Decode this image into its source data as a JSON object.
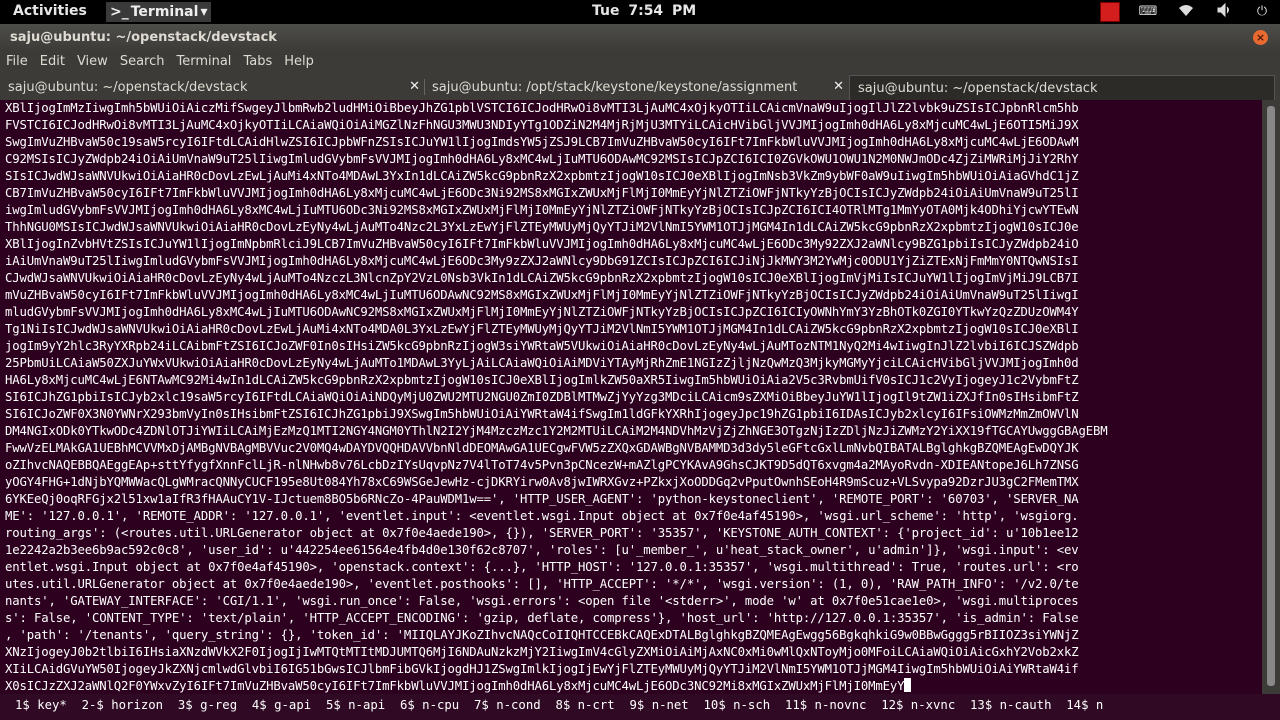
{
  "top_panel": {
    "activities": "Activities",
    "app_menu": "Terminal",
    "app_menu_icon": ">_",
    "clock": "Tue  7:54 PM",
    "tray_icons": [
      "indicator-red",
      "keyboard-icon",
      "wifi-icon",
      "volume-icon",
      "power-icon"
    ]
  },
  "window": {
    "title": "saju@ubuntu: ~/openstack/devstack",
    "close_glyph": "×"
  },
  "menu": [
    "File",
    "Edit",
    "View",
    "Search",
    "Terminal",
    "Tabs",
    "Help"
  ],
  "tabs": [
    {
      "label": "saju@ubuntu: ~/openstack/devstack",
      "close": "✕",
      "active": false
    },
    {
      "label": "saju@ubuntu: /opt/stack/keystone/keystone/assignment",
      "close": "✕",
      "active": false
    },
    {
      "label": "saju@ubuntu: ~/openstack/devstack",
      "close": "",
      "active": true
    }
  ],
  "terminal_lines": [
    "XBlIjogImMzIiwgImh5bWUiOiAiczMifSwgeyJlbmRwb2ludHMiOiBbeyJhZG1pblVSTCI6ICJodHRwOi8vMTI3LjAuMC4xOjkyOTIiLCAicmVnaW9uIjogIlJlZ2lvbk9uZSIsICJpbnRlcm5hb",
    "FVSTCI6ICJodHRwOi8vMTI3LjAuMC4xOjkyOTIiLCAiaWQiOiAiMGZlNzFhNGU3MWU3NDIyYTg1ODZiN2M4MjRjMjU3MTYiLCAicHVibGljVVJMIjogImh0dHA6Ly8xMjcuMC4wLjE6OTI5MiJ9X",
    "SwgImVuZHBvaW50c19saW5rcyI6IFtdLCAidHlwZSI6ICJpbWFnZSIsICJuYW1lIjogImdsYW5jZSJ9LCB7ImVuZHBvaW50cyI6IFt7ImFkbWluVVJMIjogImh0dHA6Ly8xMjcuMC4wLjE6ODAwM",
    "C92MSIsICJyZWdpb24iOiAiUmVnaW9uT25lIiwgImludGVybmFsVVJMIjogImh0dHA6Ly8xMC4wLjIuMTU6ODAwMC92MSIsICJpZCI6ICI0ZGVkOWU1OWU1N2M0NWJmODc4ZjZiMWRiMjJiY2RhY",
    "SIsICJwdWJsaWNVUkwiOiAiaHR0cDovLzEwLjAuMi4xNTo4MDAwL3YxIn1dLCAiZW5kcG9pbnRzX2xpbmtzIjogW10sICJ0eXBlIjogImNsb3VkZm9ybWF0aW9uIiwgIm5hbWUiOiAiaGVhdC1jZ",
    "CB7ImVuZHBvaW50cyI6IFt7ImFkbWluVVJMIjogImh0dHA6Ly8xMjcuMC4wLjE6ODc3Ni92MS8xMGIxZWUxMjFlMjI0MmEyYjNlZTZiOWFjNTkyYzBjOCIsICJyZWdpb24iOiAiUmVnaW9uT25lI",
    "iwgImludGVybmFsVVJMIjogImh0dHA6Ly8xMC4wLjIuMTU6ODc3Ni92MS8xMGIxZWUxMjFlMjI0MmEyYjNlZTZiOWFjNTkyYzBjOCIsICJpZCI6ICI4OTRlMTg1MmYyOTA0Mjk4ODhiYjcwYTEwN",
    "ThhNGU0MSIsICJwdWJsaWNVUkwiOiAiaHR0cDovLzEyNy4wLjAuMTo4Nzc2L3YxLzEwYjFlZTEyMWUyMjQyYTJiM2VlNmI5YWM1OTJjMGM4In1dLCAiZW5kcG9pbnRzX2xpbmtzIjogW10sICJ0e",
    "XBlIjogInZvbHVtZSIsICJuYW1lIjogImNpbmRlciJ9LCB7ImVuZHBvaW50cyI6IFt7ImFkbWluVVJMIjogImh0dHA6Ly8xMjcuMC4wLjE6ODc3My92ZXJ2aWNlcy9BZG1pbiIsICJyZWdpb24iO",
    "iAiUmVnaW9uT25lIiwgImludGVybmFsVVJMIjogImh0dHA6Ly8xMjcuMC4wLjE6ODc3My9zZXJ2aWNlcy9DbG91ZCIsICJpZCI6ICJiNjJkMWY3M2YwMjc0ODU1YjZiZTExNjFmMmY0NTQwNSIsI",
    "CJwdWJsaWNVUkwiOiAiaHR0cDovLzEyNy4wLjAuMTo4NzczL3NlcnZpY2VzL0Nsb3VkIn1dLCAiZW5kcG9pbnRzX2xpbmtzIjogW10sICJ0eXBlIjogImVjMiIsICJuYW1lIjogImVjMiJ9LCB7I",
    "mVuZHBvaW50cyI6IFt7ImFkbWluVVJMIjogImh0dHA6Ly8xMC4wLjIuMTU6ODAwNC92MS8xMGIxZWUxMjFlMjI0MmEyYjNlZTZiOWFjNTkyYzBjOCIsICJyZWdpb24iOiAiUmVnaW9uT25lIiwgI",
    "mludGVybmFsVVJMIjogImh0dHA6Ly8xMC4wLjIuMTU6ODAwNC92MS8xMGIxZWUxMjFlMjI0MmEyYjNlZTZiOWFjNTkyYzBjOCIsICJpZCI6ICIyOWNhYmY3YzBhOTk0ZGI0YTkwYzQzZDUzOWM4Y",
    "Tg1NiIsICJwdWJsaWNVUkwiOiAiaHR0cDovLzEwLjAuMi4xNTo4MDA0L3YxLzEwYjFlZTEyMWUyMjQyYTJiM2VlNmI5YWM1OTJjMGM4In1dLCAiZW5kcG9pbnRzX2xpbmtzIjogW10sICJ0eXBlI",
    "jogIm9yY2hlc3RyYXRpb24iLCAibmFtZSI6ICJoZWF0In0sIHsiZW5kcG9pbnRzIjogW3siYWRtaW5VUkwiOiAiaHR0cDovLzEyNy4wLjAuMTozNTM1NyQ2Mi4wIiwgInJlZ2lvbiI6ICJSZWdpb",
    "25PbmUiLCAiaW50ZXJuYWxVUkwiOiAiaHR0cDovLzEyNy4wLjAuMTo1MDAwL3YyLjAiLCAiaWQiOiAiMDViYTAyMjRhZmE1NGIzZjljNzQwMzQ3MjkyMGMyYjciLCAicHVibGljVVJMIjogImh0d",
    "HA6Ly8xMjcuMC4wLjE6NTAwMC92Mi4wIn1dLCAiZW5kcG9pbnRzX2xpbmtzIjogW10sICJ0eXBlIjogImlkZW50aXR5IiwgIm5hbWUiOiAia2V5c3RvbmUifV0sICJ1c2VyIjogeyJ1c2VybmFtZ",
    "SI6ICJhZG1pbiIsICJyb2xlc19saW5rcyI6IFtdLCAiaWQiOiAiNDQyMjU0ZWU2MTU2NGU0ZmI0ZDBlMTMwZjYyYzg3MDciLCAicm9sZXMiOiBbeyJuYW1lIjogIl9tZW1iZXJfIn0sIHsibmFtZ",
    "SI6ICJoZWF0X3N0YWNrX293bmVyIn0sIHsibmFtZSI6ICJhZG1pbiJ9XSwgIm5hbWUiOiAiYWRtaW4ifSwgIm1ldGFkYXRhIjogeyJpc19hZG1pbiI6IDAsICJyb2xlcyI6IFsiOWMzMmZmOWVlN",
    "DM4NGIxODk0YTkwODc4ZDNlOTJiYWIiLCAiMjEzMzQ1MTI2NGY4NGM0YThlN2I2YjM4MzczMzc1Y2M2MTUiLCAiM2M4NDVhMzVjZjZhNGE3OTgzNjIzZDljNzJiZWMzY2YiXX19fTGCAYUwggGBAgEBM",
    "FwwVzELMAkGA1UEBhMCVVMxDjAMBgNVBAgMBVVuc2V0MQ4wDAYDVQQHDAVVbnNldDEOMAwGA1UECgwFVW5zZXQxGDAWBgNVBAMMD3d3dy5leGFtcGxlLmNvbQIBATALBglghkgBZQMEAgEwDQYJK",
    "oZIhvcNAQEBBQAEggEAp+sttYfygfXnnFclLjR-nlNHwb8v76LcbDzIYsUqvpNz7V4lToT74v5Pvn3pCNcezW+mAZlgPCYKAvA9GhsCJKT9D5dQT6xvgm4a2MAyoRvdn-XDIEANtopeJ6Lh7ZNSG",
    "yOGY4FHG+1dNjbYQMWWacQLgWMracQNNyCUCF195e8Ut084Yh78xC69WSGeJewHz-cjDKRYirw0Av8jwIWRXGvz+PZkxjXoODDGq2vPputOwnhSEoH4R9mScuz+VLSvypa92DzrJU3gC2FMemTMX",
    "6YKEeQj0oqRFGjx2l51xw1aIfR3fHAAuCY1V-IJctuem8BO5b6RNcZo-4PauWDM1w==', 'HTTP_USER_AGENT': 'python-keystoneclient', 'REMOTE_PORT': '60703', 'SERVER_NA",
    "ME': '127.0.0.1', 'REMOTE_ADDR': '127.0.0.1', 'eventlet.input': <eventlet.wsgi.Input object at 0x7f0e4af45190>, 'wsgi.url_scheme': 'http', 'wsgiorg.",
    "routing_args': (<routes.util.URLGenerator object at 0x7f0e4aede190>, {}), 'SERVER_PORT': '35357', 'KEYSTONE_AUTH_CONTEXT': {'project_id': u'10b1ee12",
    "1e2242a2b3ee6b9ac592c0c8', 'user_id': u'442254ee61564e4fb4d0e130f62c8707', 'roles': [u'_member_', u'heat_stack_owner', u'admin']}, 'wsgi.input': <ev",
    "entlet.wsgi.Input object at 0x7f0e4af45190>, 'openstack.context': {...}, 'HTTP_HOST': '127.0.0.1:35357', 'wsgi.multithread': True, 'routes.url': <ro",
    "utes.util.URLGenerator object at 0x7f0e4aede190>, 'eventlet.posthooks': [], 'HTTP_ACCEPT': '*/*', 'wsgi.version': (1, 0), 'RAW_PATH_INFO': '/v2.0/te",
    "nants', 'GATEWAY_INTERFACE': 'CGI/1.1', 'wsgi.run_once': False, 'wsgi.errors': <open file '<stderr>', mode 'w' at 0x7f0e51cae1e0>, 'wsgi.multiproces",
    "s': False, 'CONTENT_TYPE': 'text/plain', 'HTTP_ACCEPT_ENCODING': 'gzip, deflate, compress'}, 'host_url': 'http://127.0.0.1:35357', 'is_admin': False",
    ", 'path': '/tenants', 'query_string': {}, 'token_id': 'MIIQLAYJKoZIhvcNAQcCoIIQHTCCEBkCAQExDTALBglghkgBZQMEAgEwgg56BgkqhkiG9w0BBwGggg5rBIIOZ3siYWNjZ",
    "XNzIjogeyJ0b2tlbiI6IHsiaXNzdWVkX2F0IjogIjIwMTQtMTItMDJUMTQ6MjI6NDAuNzkzMjY2IiwgImV4cGlyZXMiOiAiMjAxNC0xMi0wMlQxNToyMjo0MFoiLCAiaWQiOiAicGxhY2Vob2xkZ",
    "XIiLCAidGVuYW50IjogeyJkZXNjcmlwdGlvbiI6IG51bGwsICJlbmFibGVkIjogdHJ1ZSwgImlkIjogIjEwYjFlZTEyMWUyMjQyYTJiM2VlNmI5YWM1OTJjMGM4IiwgIm5hbWUiOiAiYWRtaW4if",
    "X0sICJzZXJ2aWNlQ2F0YWxvZyI6IFt7ImVuZHBvaW50cyI6IFt7ImFkbWluVVJMIjogImh0dHA6Ly8xMjcuMC4wLjE6ODc3NC92Mi8xMGIxZWUxMjFlMjI0MmEyY"
  ],
  "status_bar": "1$ key*  2-$ horizon  3$ g-reg  4$ g-api  5$ n-api  6$ n-cpu  7$ n-cond  8$ n-crt  9$ n-net  10$ n-sch  11$ n-novnc  12$ n-xvnc  13$ n-cauth  14$ n"
}
